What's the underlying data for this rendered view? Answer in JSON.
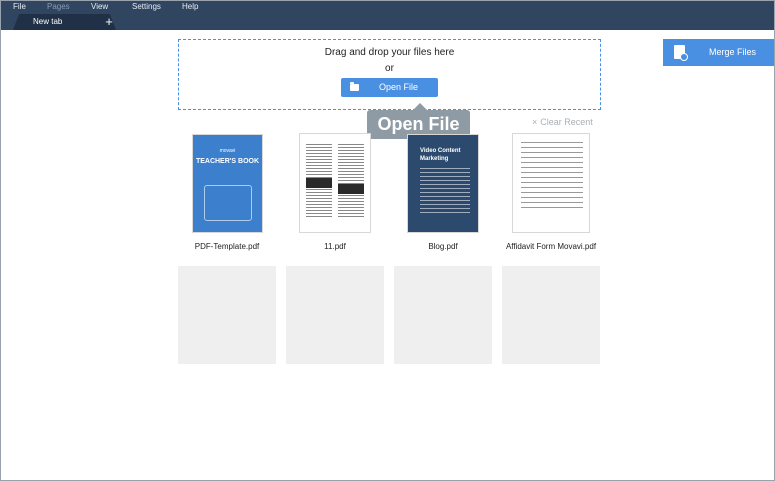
{
  "menu": {
    "file": "File",
    "pages": "Pages",
    "view": "View",
    "settings": "Settings",
    "help": "Help"
  },
  "tabs": {
    "active_label": "New tab",
    "new_tab_symbol": "+"
  },
  "dropzone": {
    "instruction": "Drag and drop your files here",
    "or": "or",
    "open_button": "Open File",
    "open_icon": "folder-icon"
  },
  "tooltip": "Open File",
  "merge": {
    "label": "Merge Files",
    "icon": "merge-document-icon"
  },
  "clear_recent": {
    "icon": "close-icon",
    "symbol": "×",
    "label": "Clear Recent"
  },
  "recent_files": [
    {
      "name": "PDF-Template.pdf",
      "cover_brand": "movavi",
      "cover_title": "TEACHER'S BOOK"
    },
    {
      "name": "11.pdf"
    },
    {
      "name": "Blog.pdf",
      "cover_title": "Video Content Marketing"
    },
    {
      "name": "Affidavit Form Movavi.pdf"
    }
  ],
  "colors": {
    "titlebar": "#2f4560",
    "accent": "#4a90e2",
    "tooltip": "#8e9aa4",
    "placeholder": "#efefef"
  }
}
